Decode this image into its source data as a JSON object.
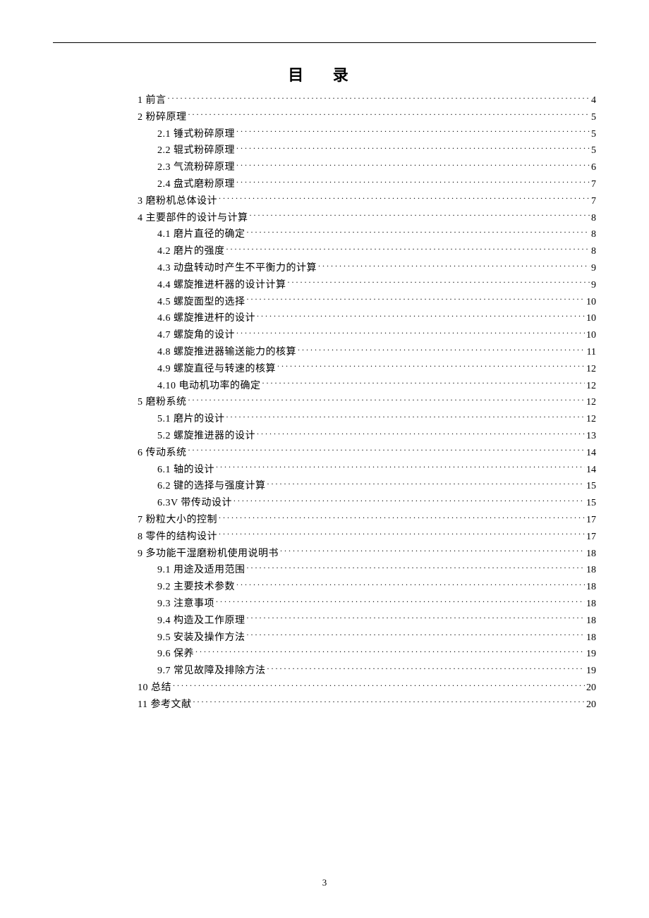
{
  "title": "目 录",
  "page_number": "3",
  "toc": [
    {
      "level": 1,
      "label": "1 前言",
      "page": "4"
    },
    {
      "level": 1,
      "label": "2 粉碎原理",
      "page": "5"
    },
    {
      "level": 2,
      "label": "2.1 锤式粉碎原理",
      "page": "5"
    },
    {
      "level": 2,
      "label": "2.2 辊式粉碎原理",
      "page": "5"
    },
    {
      "level": 2,
      "label": "2.3 气流粉碎原理",
      "page": "6"
    },
    {
      "level": 2,
      "label": "2.4 盘式磨粉原理",
      "page": "7"
    },
    {
      "level": 1,
      "label": "3 磨粉机总体设计",
      "page": "7"
    },
    {
      "level": 1,
      "label": "4 主要部件的设计与计算",
      "page": "8"
    },
    {
      "level": 2,
      "label": "4.1 磨片直径的确定",
      "page": "8"
    },
    {
      "level": 2,
      "label": "4.2 磨片的强度",
      "page": "8"
    },
    {
      "level": 2,
      "label": "4.3 动盘转动时产生不平衡力的计算",
      "page": "9"
    },
    {
      "level": 2,
      "label": "4.4 螺旋推进杆器的设计计算",
      "page": "9"
    },
    {
      "level": 2,
      "label": "4.5 螺旋面型的选择",
      "page": "10"
    },
    {
      "level": 2,
      "label": "4.6 螺旋推进杆的设计",
      "page": "10"
    },
    {
      "level": 2,
      "label": "4.7 螺旋角的设计",
      "page": "10"
    },
    {
      "level": 2,
      "label": "4.8 螺旋推进器输送能力的核算",
      "page": "11"
    },
    {
      "level": 2,
      "label": "4.9 螺旋直径与转速的核算",
      "page": "12"
    },
    {
      "level": 2,
      "label": "4.10 电动机功率的确定",
      "page": "12"
    },
    {
      "level": 1,
      "label": "5 磨粉系统",
      "page": "12"
    },
    {
      "level": 2,
      "label": "5.1 磨片的设计",
      "page": "12"
    },
    {
      "level": 2,
      "label": "5.2 螺旋推进器的设计",
      "page": "13"
    },
    {
      "level": 1,
      "label": "6 传动系统",
      "page": "14"
    },
    {
      "level": 2,
      "label": "6.1 轴的设计",
      "page": "14"
    },
    {
      "level": 2,
      "label": "6.2 键的选择与强度计算",
      "page": "15"
    },
    {
      "level": 2,
      "label": "6.3V 带传动设计",
      "page": "15"
    },
    {
      "level": 1,
      "label": "7 粉粒大小的控制",
      "page": "17"
    },
    {
      "level": 1,
      "label": "8 零件的结构设计",
      "page": "17"
    },
    {
      "level": 1,
      "label": "9 多功能干湿磨粉机使用说明书",
      "page": "18"
    },
    {
      "level": 2,
      "label": "9.1 用途及适用范围",
      "page": "18"
    },
    {
      "level": 2,
      "label": "9.2 主要技术参数",
      "page": "18"
    },
    {
      "level": 2,
      "label": "9.3 注意事项",
      "page": "18"
    },
    {
      "level": 2,
      "label": "9.4 构造及工作原理",
      "page": "18"
    },
    {
      "level": 2,
      "label": "9.5 安装及操作方法",
      "page": "18"
    },
    {
      "level": 2,
      "label": "9.6 保养",
      "page": "19"
    },
    {
      "level": 2,
      "label": "9.7 常见故障及排除方法",
      "page": "19"
    },
    {
      "level": 1,
      "label": "10 总结",
      "page": "20"
    },
    {
      "level": 1,
      "label": "11 参考文献",
      "page": "20"
    }
  ]
}
